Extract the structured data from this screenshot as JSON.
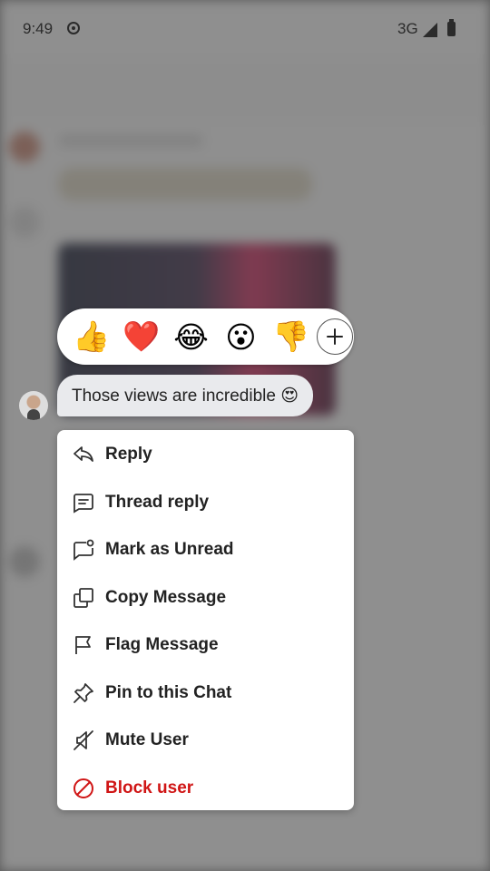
{
  "status_bar": {
    "time": "9:49",
    "network": "3G"
  },
  "reactions": [
    {
      "emoji": "👍",
      "name": "thumbs-up"
    },
    {
      "emoji": "❤️",
      "name": "heart"
    },
    {
      "emoji": "😂",
      "name": "laughing"
    },
    {
      "emoji": "😮",
      "name": "surprised"
    },
    {
      "emoji": "👎",
      "name": "thumbs-down"
    }
  ],
  "message": {
    "text": "Those views are incredible 😍"
  },
  "menu": {
    "reply": "Reply",
    "thread_reply": "Thread reply",
    "mark_unread": "Mark as Unread",
    "copy_message": "Copy Message",
    "flag_message": "Flag Message",
    "pin_chat": "Pin to this Chat",
    "mute_user": "Mute User",
    "block_user": "Block user"
  },
  "colors": {
    "danger": "#d01515",
    "overlay": "#7d7d7d"
  }
}
